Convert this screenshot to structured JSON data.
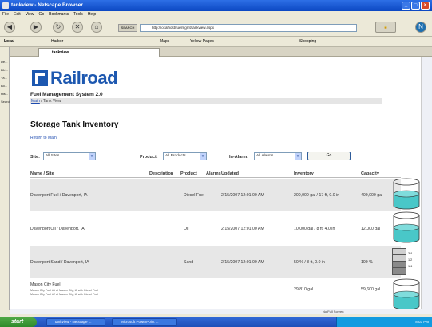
{
  "window": {
    "title": "tankview - Netscape Browser"
  },
  "menu": [
    "File",
    "Edit",
    "View",
    "Go",
    "Bookmarks",
    "Tools",
    "Help"
  ],
  "nav": {
    "search_label": "SEARCH",
    "url": "http://localhost/fuelmgmt/tankview.aspx"
  },
  "toolbar2": {
    "local": "Local",
    "items": [
      "Harbor",
      "Maps",
      "Yellow Pages",
      "Shopping"
    ]
  },
  "tab": {
    "label": "tankview"
  },
  "sidebar": {
    "items": [
      "De...",
      "AC...",
      "Ya...",
      "Bo...",
      "His...",
      "Search"
    ]
  },
  "page": {
    "logo_text": "Railroad",
    "system_title": "Fuel Management System 2.0",
    "breadcrumb": {
      "main": "Main",
      "current": " / Tank View"
    },
    "heading": "Storage Tank Inventory",
    "return_link": "Return to Main"
  },
  "filters": {
    "site_label": "Site:",
    "site_value": "All Sites",
    "product_label": "Product:",
    "product_value": "All Products",
    "alarm_label": "In-Alarm:",
    "alarm_value": "All Alarms",
    "go_label": "Go"
  },
  "table": {
    "headers": [
      "Name / Site",
      "Description",
      "Product",
      "Alarms",
      "Updated",
      "Inventory",
      "Capacity"
    ],
    "rows": [
      {
        "name": "Davenport Fuel / Davenport, IA",
        "product": "Diesel Fuel",
        "updated": "2/15/2007 12:01:00 AM",
        "inventory": "200,000 gal / 17 ft, 0.0 in",
        "capacity": "400,000 gal",
        "level": 0.5
      },
      {
        "name": "Davenport Oil / Davenport, IA",
        "product": "Oil",
        "updated": "2/15/2007 12:01:00 AM",
        "inventory": "10,000 gal / 8 ft, 4.0 in",
        "capacity": "12,000 gal",
        "level": 0.5
      },
      {
        "name": "Davenport Sand / Davenport, IA",
        "product": "Sand",
        "updated": "2/15/2007 12:01:00 AM",
        "inventory": "50 % / 8 ft, 0.0 in",
        "capacity": "100 %",
        "gauge_labels": [
          "3/4",
          "1/2",
          "1/4"
        ]
      },
      {
        "name": "Mason City Fuel",
        "sub1": "Mason City Fuel #1 at Mason City, IA with Diesel Fuel",
        "sub2": "Mason City Fuel #2 at Mason City, IA with Diesel Fuel",
        "inventory": "29,810 gal",
        "capacity": "59,600 gal",
        "level": 0.5
      }
    ]
  },
  "status": {
    "text": "No Full Screen"
  },
  "taskbar": {
    "start": "start",
    "items": [
      "tankview - Netscape ...",
      "Microsoft PowerPoint ..."
    ],
    "clock": "8:03 PM"
  },
  "colors": {
    "tank_fill": "#49c7c8",
    "brand": "#1d58b0"
  }
}
